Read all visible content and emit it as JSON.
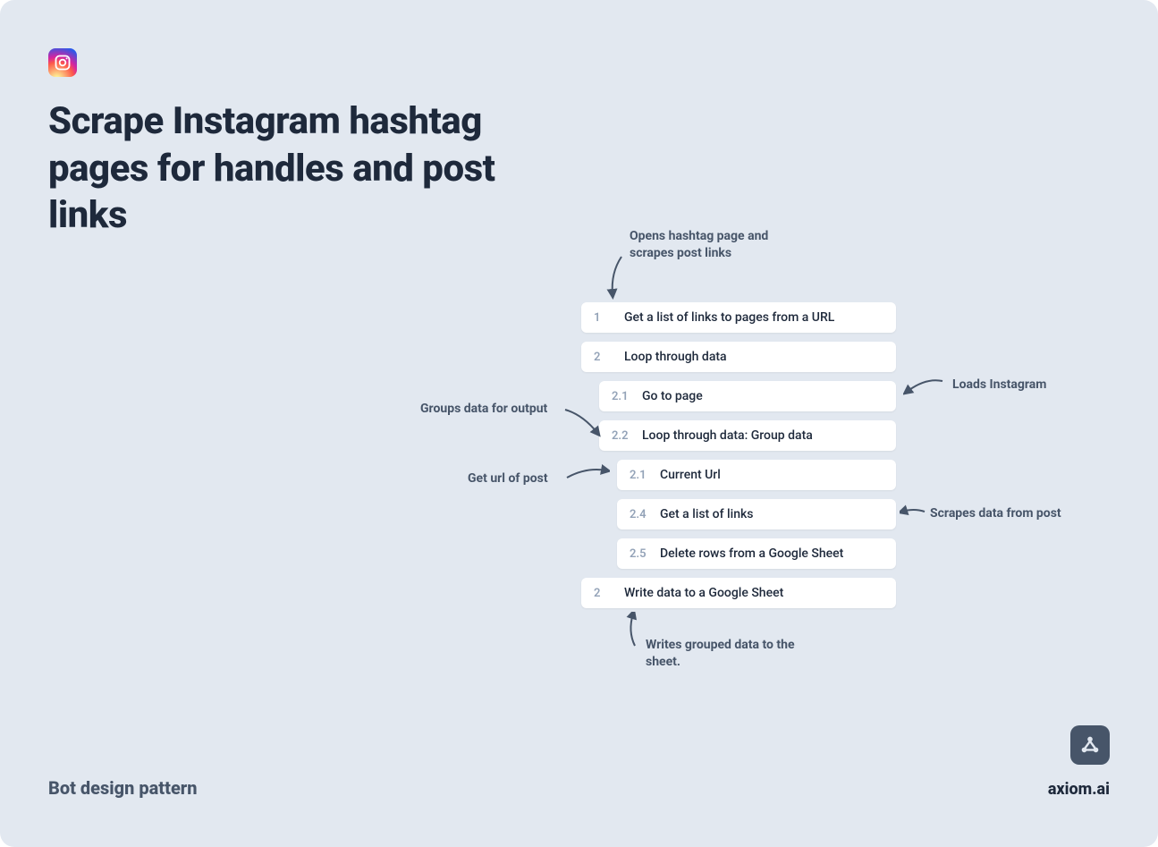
{
  "title": "Scrape Instagram hashtag pages for handles and post links",
  "footer_left": "Bot design pattern",
  "footer_right": "axiom.ai",
  "steps": [
    {
      "num": "1",
      "label": "Get a list of links to pages from a URL",
      "indent": 0
    },
    {
      "num": "2",
      "label": "Loop through data",
      "indent": 0
    },
    {
      "num": "2.1",
      "label": "Go to page",
      "indent": 1
    },
    {
      "num": "2.2",
      "label": "Loop through data: Group data",
      "indent": 1
    },
    {
      "num": "2.1",
      "label": "Current Url",
      "indent": 2
    },
    {
      "num": "2.4",
      "label": "Get a list of links",
      "indent": 2
    },
    {
      "num": "2.5",
      "label": "Delete rows from a Google Sheet",
      "indent": 2
    },
    {
      "num": "2",
      "label": "Write data to a Google Sheet",
      "indent": 0
    }
  ],
  "annotations": {
    "opens_hashtag": "Opens hashtag page and scrapes post links",
    "loads_instagram": "Loads Instagram",
    "groups_data": "Groups data for output",
    "get_url": "Get url of post",
    "scrapes_post": "Scrapes data from post",
    "writes_sheet": "Writes grouped data to the sheet."
  }
}
